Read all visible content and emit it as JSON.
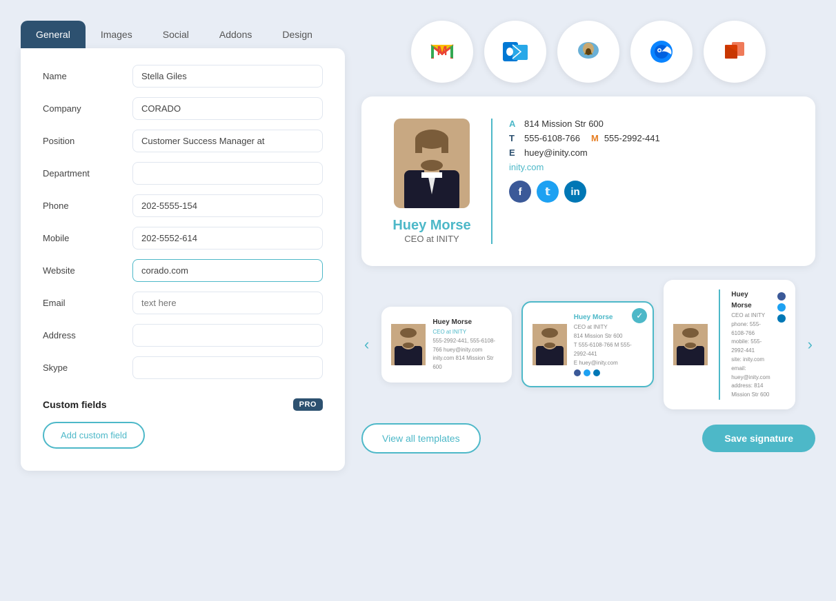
{
  "tabs": [
    {
      "label": "General",
      "active": true
    },
    {
      "label": "Images",
      "active": false
    },
    {
      "label": "Social",
      "active": false
    },
    {
      "label": "Addons",
      "active": false
    },
    {
      "label": "Design",
      "active": false
    }
  ],
  "form": {
    "name_label": "Name",
    "name_value": "Stella Giles",
    "company_label": "Company",
    "company_value": "CORADO",
    "position_label": "Position",
    "position_value": "Customer Success Manager at",
    "department_label": "Department",
    "department_value": "",
    "phone_label": "Phone",
    "phone_value": "202-5555-154",
    "mobile_label": "Mobile",
    "mobile_value": "202-5552-614",
    "website_label": "Website",
    "website_value": "corado.com",
    "email_label": "Email",
    "email_placeholder": "text here",
    "address_label": "Address",
    "address_value": "",
    "skype_label": "Skype",
    "skype_value": ""
  },
  "custom_fields": {
    "title": "Custom fields",
    "pro_badge": "PRO",
    "add_btn": "Add custom field"
  },
  "email_clients": [
    {
      "name": "Gmail",
      "icon": "M"
    },
    {
      "name": "Outlook",
      "icon": "O"
    },
    {
      "name": "Apple Mail",
      "icon": "A"
    },
    {
      "name": "Thunderbird",
      "icon": "T"
    },
    {
      "name": "Office 365",
      "icon": "O3"
    }
  ],
  "signature": {
    "name": "Huey Morse",
    "title": "CEO at INITY",
    "address_label": "A",
    "address_value": "814 Mission Str 600",
    "phone_label": "T",
    "phone_value": "555-6108-766",
    "mobile_label": "M",
    "mobile_value": "555-2992-441",
    "email_label": "E",
    "email_value": "huey@inity.com",
    "website": "inity.com",
    "socials": [
      "facebook",
      "twitter",
      "linkedin"
    ]
  },
  "templates": [
    {
      "id": 1,
      "name": "Huey Morse",
      "title": "CEO at INITY",
      "details": "555-2992-441, 555-6108-766\nhuey@inity.com\ninity.com\n814 Mission Str 600",
      "selected": false
    },
    {
      "id": 2,
      "name": "Huey Morse",
      "title": "CEO at INITY",
      "address": "814 Mission Str 600",
      "phone": "T  555-6108-766  M  555-2992-441",
      "email": "E  huey@inity.com",
      "selected": true
    },
    {
      "id": 3,
      "name": "Huey Morse",
      "title": "CEO at INITY",
      "phone_line": "phone: 555-6108-766",
      "mobile_line": "mobile: 555-2992-441",
      "site_line": "site: inity.com",
      "email_line": "email: huey@inity.com",
      "address_line": "address: 814 Mission Str 600",
      "selected": false
    }
  ],
  "actions": {
    "view_all": "View all templates",
    "save": "Save signature"
  }
}
